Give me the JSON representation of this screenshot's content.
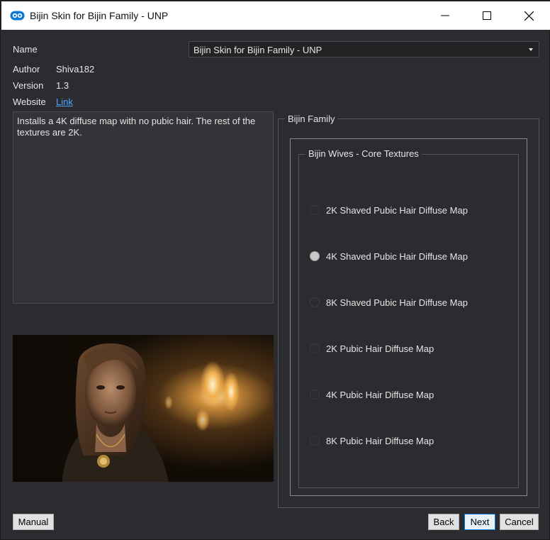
{
  "window": {
    "title": "Bijin Skin for Bijin Family - UNP"
  },
  "fields": {
    "name_label": "Name",
    "name_value": "Bijin Skin for Bijin Family - UNP",
    "author_label": "Author",
    "author_value": "Shiva182",
    "version_label": "Version",
    "version_value": "1.3",
    "website_label": "Website",
    "website_link": "Link"
  },
  "description": "Installs a 4K diffuse map with no pubic hair. The rest of the textures are 2K.",
  "group": {
    "outer_title": "Bijin Family",
    "inner_title": "Bijin Wives - Core Textures",
    "options": [
      {
        "label": "2K Shaved Pubic Hair Diffuse Map",
        "checked": false
      },
      {
        "label": "4K Shaved Pubic Hair Diffuse Map",
        "checked": true
      },
      {
        "label": "8K Shaved Pubic Hair Diffuse Map",
        "checked": false
      },
      {
        "label": "2K Pubic Hair Diffuse Map",
        "checked": false
      },
      {
        "label": "4K Pubic Hair Diffuse Map",
        "checked": false
      },
      {
        "label": "8K Pubic Hair Diffuse Map",
        "checked": false
      }
    ]
  },
  "buttons": {
    "manual": "Manual",
    "back": "Back",
    "next": "Next",
    "cancel": "Cancel"
  },
  "icons": {
    "app": "mod-organizer-icon",
    "minimize": "minimize-icon",
    "maximize": "maximize-icon",
    "close": "close-icon",
    "dropdown": "chevron-down-icon"
  },
  "colors": {
    "background": "#2b2b30",
    "link": "#4ea3ff",
    "primary_button_border": "#0078d7"
  }
}
